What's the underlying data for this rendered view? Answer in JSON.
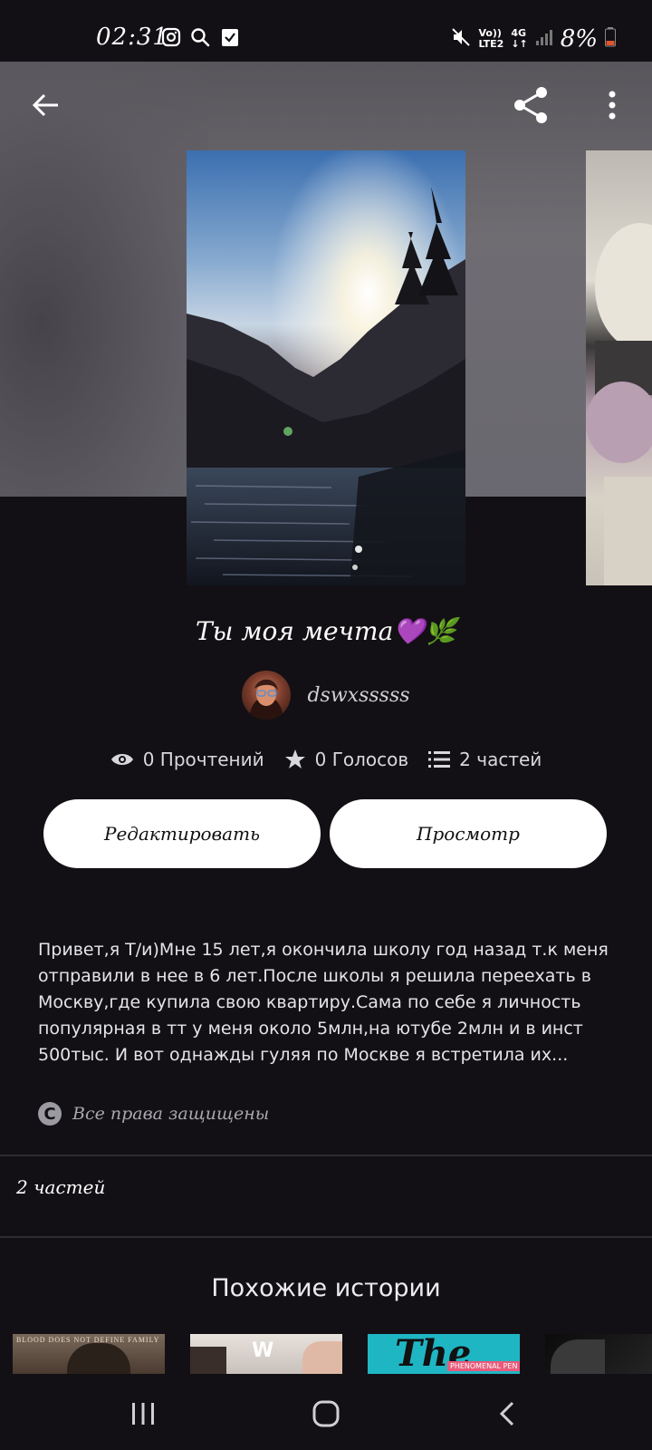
{
  "status_bar": {
    "time": "02:31",
    "network_label": "LTE2",
    "network_type": "4G",
    "battery": "8%"
  },
  "header": {
    "back_icon": "arrow-left-icon",
    "share_icon": "share-icon",
    "more_icon": "more-vert-icon"
  },
  "story": {
    "title": "Ты моя мечта💜🌿",
    "author": "dswxsssss",
    "stats": {
      "reads": "0 Прочтений",
      "votes": "0 Голосов",
      "parts": "2 частей"
    },
    "edit_button": "Редактировать",
    "preview_button": "Просмотр",
    "description": "Привет,я Т/и)Мне 15 лет,я окончила школу год назад т.к меня отправили в нее в 6 лет.После школы я решила переехать в Москву,где купила свою квартиру.Сама по себе я личность популярная в тт у меня около 5млн,на ютубе 2млн и в инст 500тыс. И вот однажды гуляя по Москве я встретила их...",
    "copyright_symbol": "C",
    "rights": "Все права защищены",
    "parts_count": "2 частей"
  },
  "similar": {
    "title": "Похожие истории",
    "thumb1_text": "BLOOD DOES NOT DEFINE FAMILY",
    "thumb2_text": "W",
    "thumb3_big": "The",
    "thumb3_tag": "PHENOMENAL PEN"
  },
  "colors": {
    "background": "#121014",
    "button_bg": "#ffffff",
    "divider": "#2e2c31"
  }
}
